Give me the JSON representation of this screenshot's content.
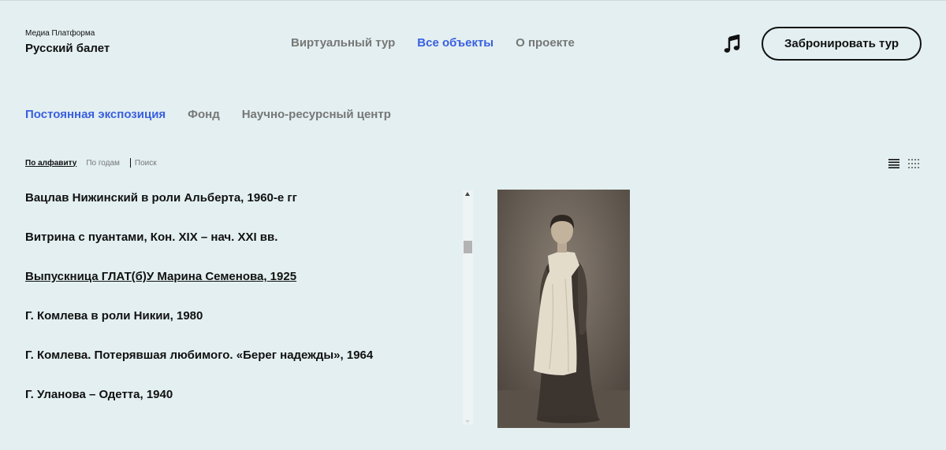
{
  "brand": {
    "subtitle": "Медиа Платформа",
    "title": "Русский балет"
  },
  "nav": [
    {
      "label": "Виртуальный тур",
      "active": false
    },
    {
      "label": "Все объекты",
      "active": true
    },
    {
      "label": "О проекте",
      "active": false
    }
  ],
  "header": {
    "book_label": "Забронировать тур",
    "music_icon": "music-note-icon"
  },
  "tabs": [
    {
      "label": "Постоянная экспозиция",
      "active": true
    },
    {
      "label": "Фонд",
      "active": false
    },
    {
      "label": "Научно-ресурсный центр",
      "active": false
    }
  ],
  "sort": {
    "alphabet": "По алфавиту",
    "years": "По годам",
    "search": "Поиск",
    "selected": "alphabet"
  },
  "view_toggle": {
    "list_icon": "list-view-icon",
    "grid_icon": "grid-view-icon"
  },
  "items": [
    "Вацлав Нижинский в роли Альберта, 1960-е гг",
    "Витрина с пуантами, Кон. XIX – нач. XXI вв.",
    "Выпускница ГЛАТ(б)У Марина Семенова, 1925",
    "Г. Комлева в роли Никии, 1980",
    "Г. Комлева. Потерявшая любимого. «Берег надежды», 1964",
    "Г. Уланова – Одетта, 1940"
  ],
  "active_item": 2,
  "colors": {
    "accent": "#3a5fe0",
    "background": "#e3eff0",
    "muted": "#777777",
    "text": "#111111"
  }
}
